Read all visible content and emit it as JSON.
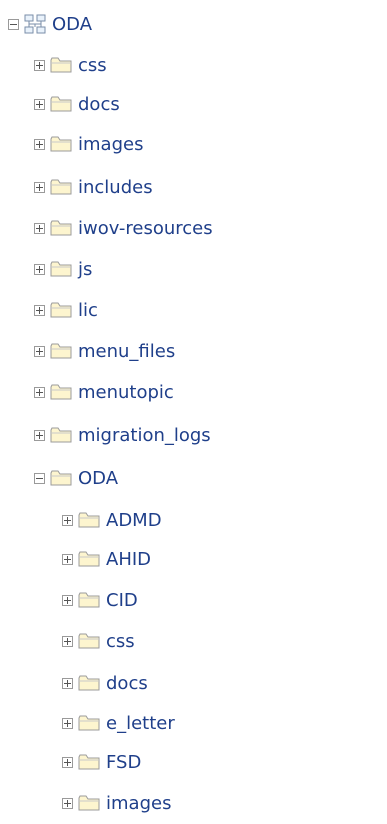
{
  "tree": {
    "root": {
      "label": "ODA",
      "expanded": true,
      "icon": "network-folders-icon"
    },
    "children": [
      {
        "label": "css",
        "expanded": false
      },
      {
        "label": "docs",
        "expanded": false
      },
      {
        "label": "images",
        "expanded": false
      },
      {
        "label": "includes",
        "expanded": false
      },
      {
        "label": "iwov-resources",
        "expanded": false
      },
      {
        "label": "js",
        "expanded": false
      },
      {
        "label": "lic",
        "expanded": false
      },
      {
        "label": "menu_files",
        "expanded": false
      },
      {
        "label": "menutopic",
        "expanded": false
      },
      {
        "label": "migration_logs",
        "expanded": false
      },
      {
        "label": "ODA",
        "expanded": true,
        "children": [
          {
            "label": "ADMD",
            "expanded": false
          },
          {
            "label": "AHID",
            "expanded": false
          },
          {
            "label": "CID",
            "expanded": false
          },
          {
            "label": "css",
            "expanded": false
          },
          {
            "label": "docs",
            "expanded": false
          },
          {
            "label": "e_letter",
            "expanded": false
          },
          {
            "label": "FSD",
            "expanded": false
          },
          {
            "label": "images",
            "expanded": false
          }
        ]
      }
    ]
  },
  "colors": {
    "text": "#1f3f8a",
    "folder_fill": "#fdf5cf",
    "folder_stroke": "#9b9b9b"
  }
}
